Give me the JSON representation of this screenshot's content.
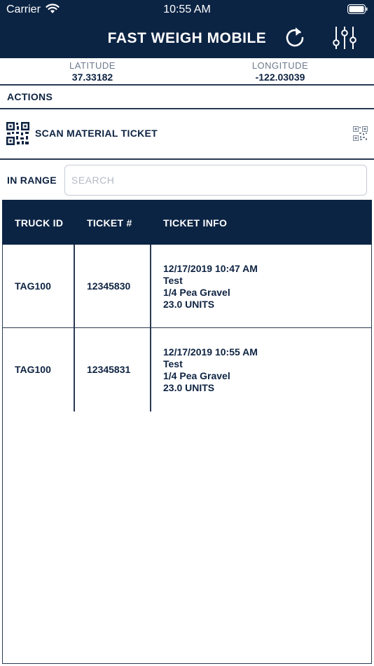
{
  "status_bar": {
    "carrier": "Carrier",
    "time": "10:55 AM"
  },
  "header": {
    "title": "FAST WEIGH MOBILE",
    "background": "#0c2444"
  },
  "location": {
    "latitude_label": "LATITUDE",
    "latitude_value": "37.33182",
    "longitude_label": "LONGITUDE",
    "longitude_value": "-122.03039"
  },
  "actions": {
    "section_label": "ACTIONS",
    "scan_label": "SCAN MATERIAL TICKET"
  },
  "filter": {
    "range_label": "IN RANGE",
    "search_placeholder": "SEARCH",
    "search_value": ""
  },
  "table": {
    "columns": [
      "TRUCK ID",
      "TICKET #",
      "TICKET INFO"
    ],
    "rows": [
      {
        "truck_id": "TAG100",
        "ticket_no": "12345830",
        "info": [
          "12/17/2019 10:47 AM",
          "Test",
          "1/4 Pea Gravel",
          "23.0 UNITS"
        ]
      },
      {
        "truck_id": "TAG100",
        "ticket_no": "12345831",
        "info": [
          "12/17/2019 10:55 AM",
          "Test",
          "1/4 Pea Gravel",
          "23.0 UNITS"
        ]
      }
    ]
  }
}
